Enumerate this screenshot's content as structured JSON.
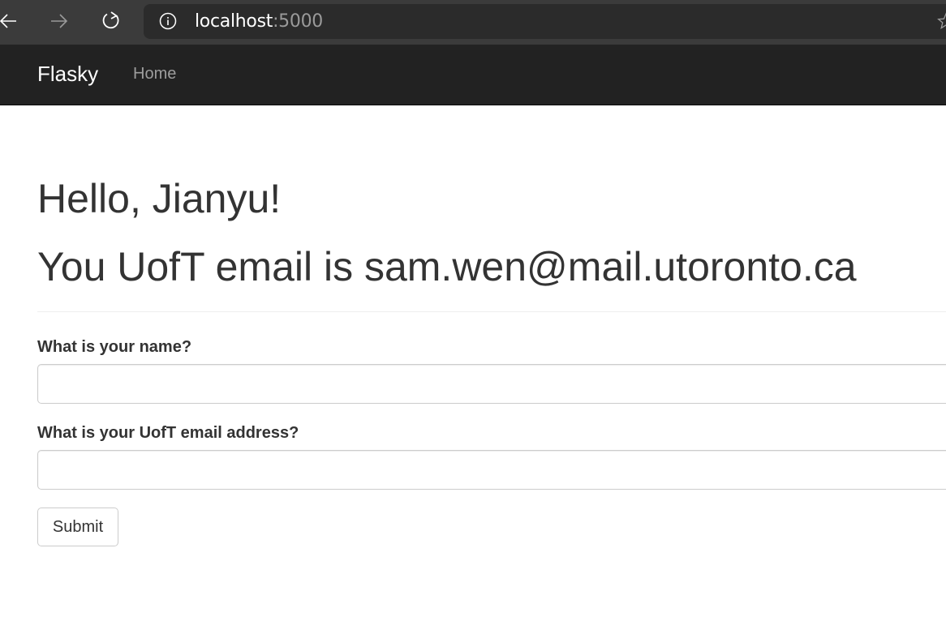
{
  "browser": {
    "url_host": "localhost",
    "url_port": ":5000",
    "icons": {
      "back": "back-arrow-icon",
      "forward": "forward-arrow-icon",
      "reload": "reload-icon",
      "info": "info-icon",
      "favorite": "star-icon"
    }
  },
  "navbar": {
    "brand": "Flasky",
    "links": [
      {
        "label": "Home"
      }
    ]
  },
  "main": {
    "greeting": "Hello, Jianyu!",
    "email_message": "You UofT email is sam.wen@mail.utoronto.ca"
  },
  "form": {
    "name_label": "What is your name?",
    "name_value": "",
    "email_label": "What is your UofT email address?",
    "email_value": "",
    "submit_label": "Submit"
  },
  "colors": {
    "browser_chrome": "#3b3b3b",
    "address_bar": "#2b2b2b",
    "navbar_bg": "#222222",
    "navbar_link": "#9d9d9d",
    "text": "#333333"
  }
}
